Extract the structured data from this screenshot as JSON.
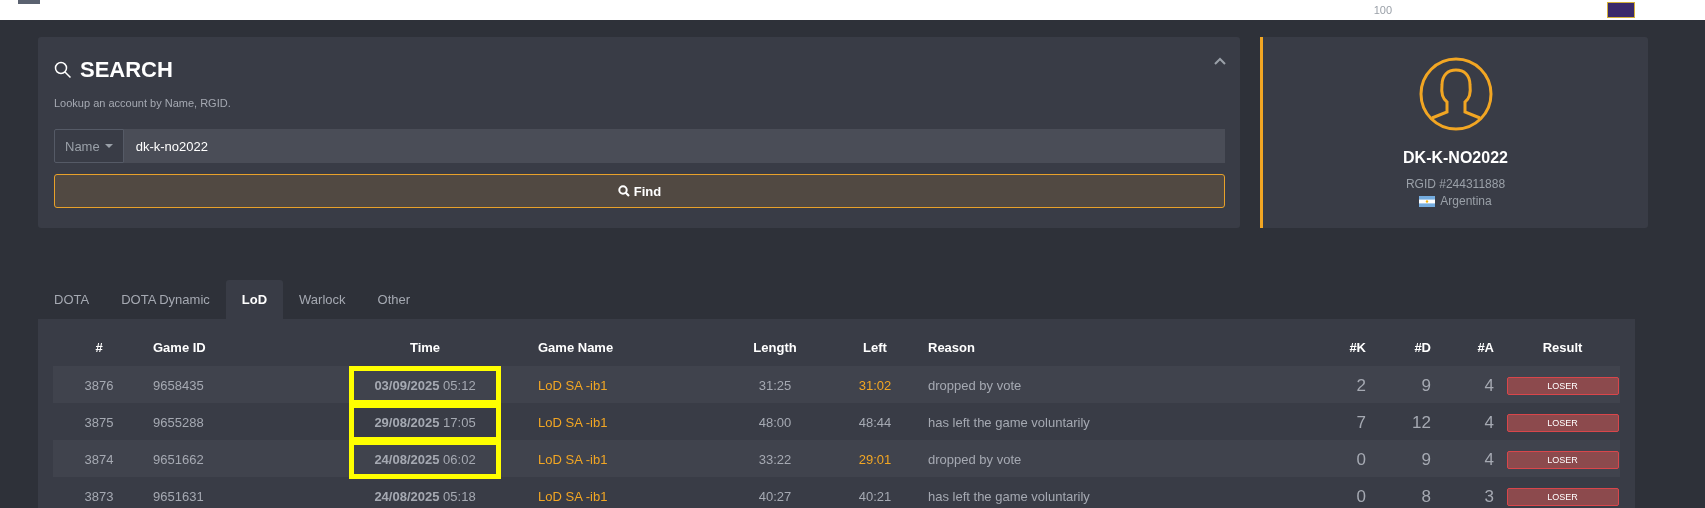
{
  "top_bar": {
    "counter": "100"
  },
  "search": {
    "title": "SEARCH",
    "subtitle": "Lookup an account by Name, RGID.",
    "mode": "Name",
    "value": "dk-k-no2022",
    "button": "Find"
  },
  "profile": {
    "name": "DK-K-NO2022",
    "rgid": "RGID #244311888",
    "country": "Argentina"
  },
  "tabs": [
    {
      "label": "DOTA",
      "selected": false
    },
    {
      "label": "DOTA Dynamic",
      "selected": false
    },
    {
      "label": "LoD",
      "selected": true
    },
    {
      "label": "Warlock",
      "selected": false
    },
    {
      "label": "Other",
      "selected": false
    }
  ],
  "table": {
    "columns": [
      "#",
      "Game ID",
      "Time",
      "Game Name",
      "Length",
      "Left",
      "Reason",
      "#K",
      "#D",
      "#A",
      "Result"
    ],
    "rows": [
      {
        "num": "3876",
        "game_id": "9658435",
        "date": "03/09/2025",
        "time": "05:12",
        "highlighted": true,
        "game_name": "LoD SA -ib1",
        "length": "31:25",
        "left": "31:02",
        "left_early": true,
        "reason": "dropped by vote",
        "k": "2",
        "d": "9",
        "a": "4",
        "result": "LOSER"
      },
      {
        "num": "3875",
        "game_id": "9655288",
        "date": "29/08/2025",
        "time": "17:05",
        "highlighted": true,
        "game_name": "LoD SA -ib1",
        "length": "48:00",
        "left": "48:44",
        "left_early": false,
        "reason": "has left the game voluntarily",
        "k": "7",
        "d": "12",
        "a": "4",
        "result": "LOSER"
      },
      {
        "num": "3874",
        "game_id": "9651662",
        "date": "24/08/2025",
        "time": "06:02",
        "highlighted": true,
        "game_name": "LoD SA -ib1",
        "length": "33:22",
        "left": "29:01",
        "left_early": true,
        "reason": "dropped by vote",
        "k": "0",
        "d": "9",
        "a": "4",
        "result": "LOSER"
      },
      {
        "num": "3873",
        "game_id": "9651631",
        "date": "24/08/2025",
        "time": "05:18",
        "highlighted": false,
        "game_name": "LoD SA -ib1",
        "length": "40:27",
        "left": "40:21",
        "left_early": false,
        "reason": "has left the game voluntarily",
        "k": "0",
        "d": "8",
        "a": "3",
        "result": "LOSER"
      }
    ]
  }
}
